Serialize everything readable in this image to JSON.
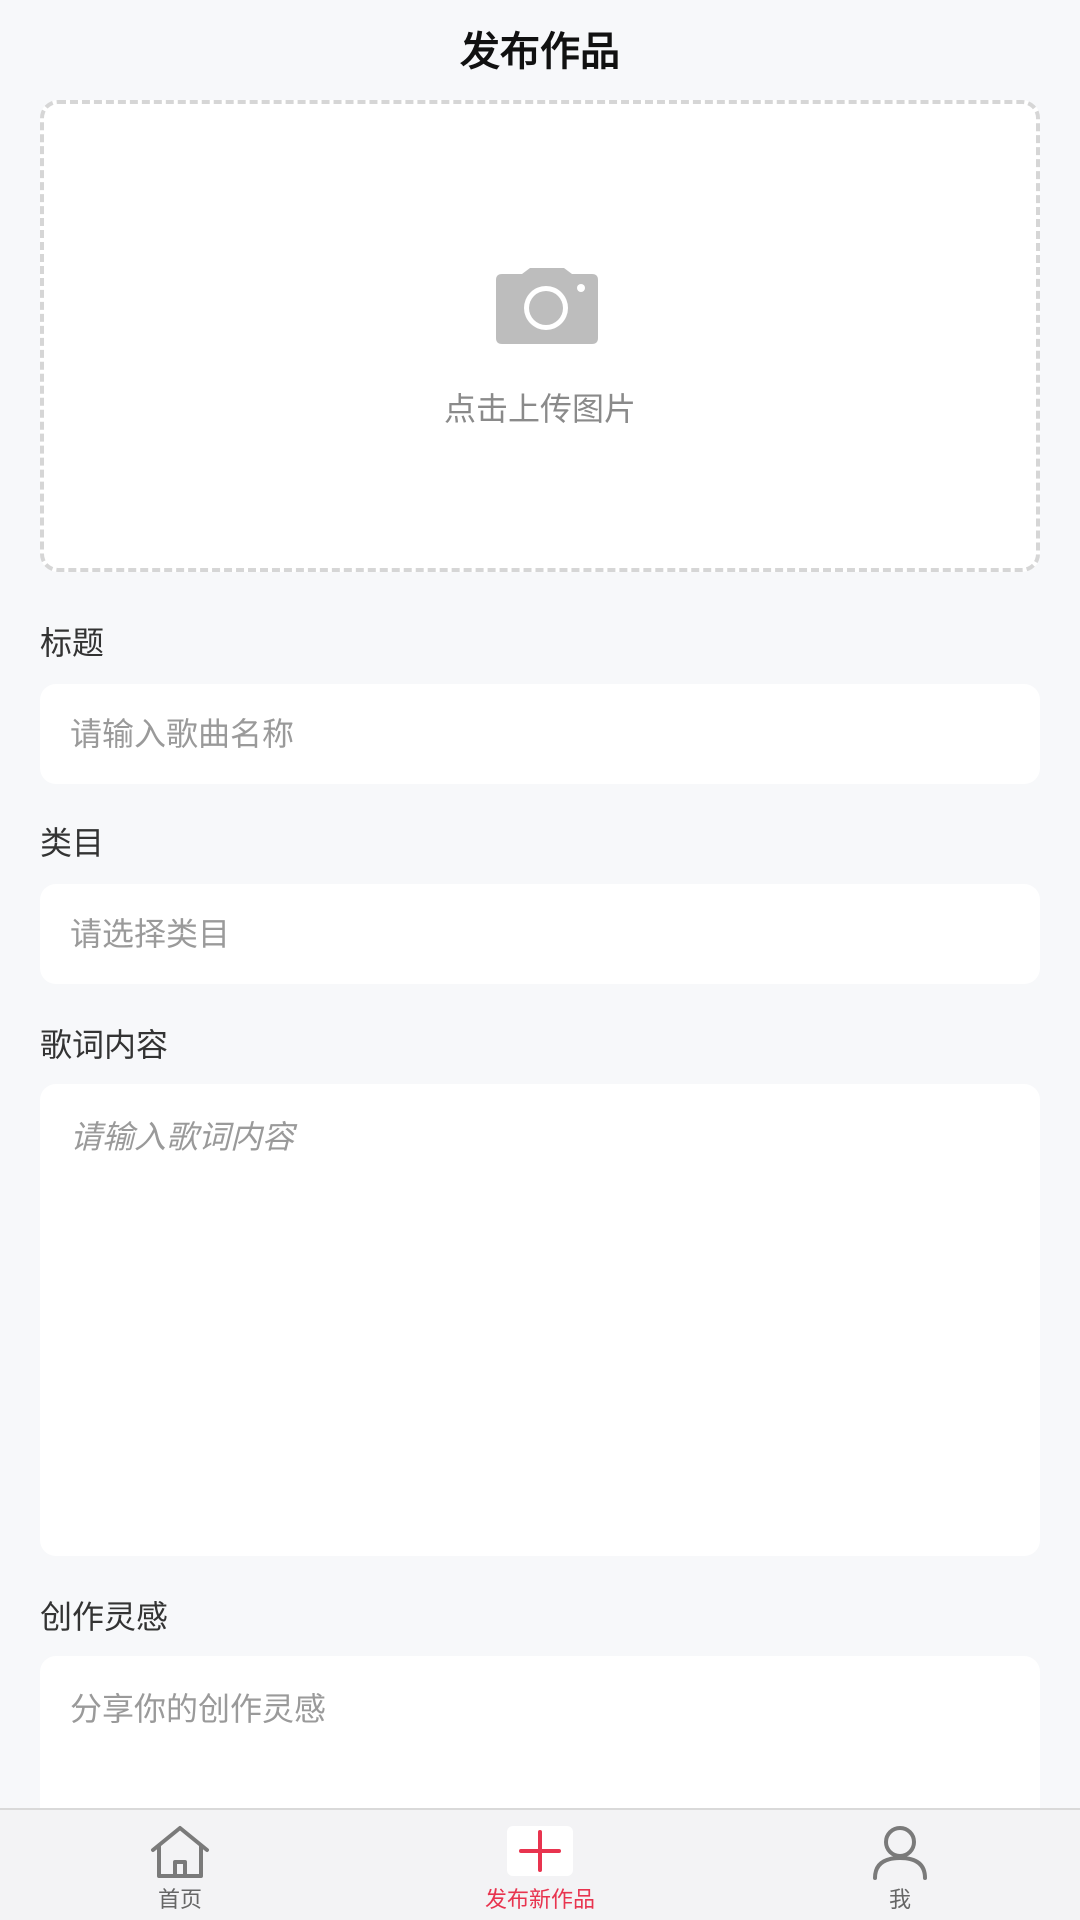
{
  "header": {
    "title": "发布作品"
  },
  "upload": {
    "icon": "camera-icon",
    "label": "点击上传图片"
  },
  "form": {
    "title": {
      "label": "标题",
      "placeholder": "请输入歌曲名称"
    },
    "category": {
      "label": "类目",
      "placeholder": "请选择类目"
    },
    "lyrics": {
      "label": "歌词内容",
      "placeholder": "请输入歌词内容"
    },
    "inspiration": {
      "label": "创作灵感",
      "placeholder": "分享你的创作灵感"
    }
  },
  "tabbar": {
    "items": [
      {
        "label": "首页",
        "icon": "home-icon",
        "active": false
      },
      {
        "label": "发布新作品",
        "icon": "plus-icon",
        "active": true
      },
      {
        "label": "我",
        "icon": "user-icon",
        "active": false
      }
    ]
  },
  "colors": {
    "accent": "#e8344f",
    "background": "#f7f8fa",
    "placeholder": "#9a9a9a",
    "icon_gray": "#bdbdbd"
  }
}
